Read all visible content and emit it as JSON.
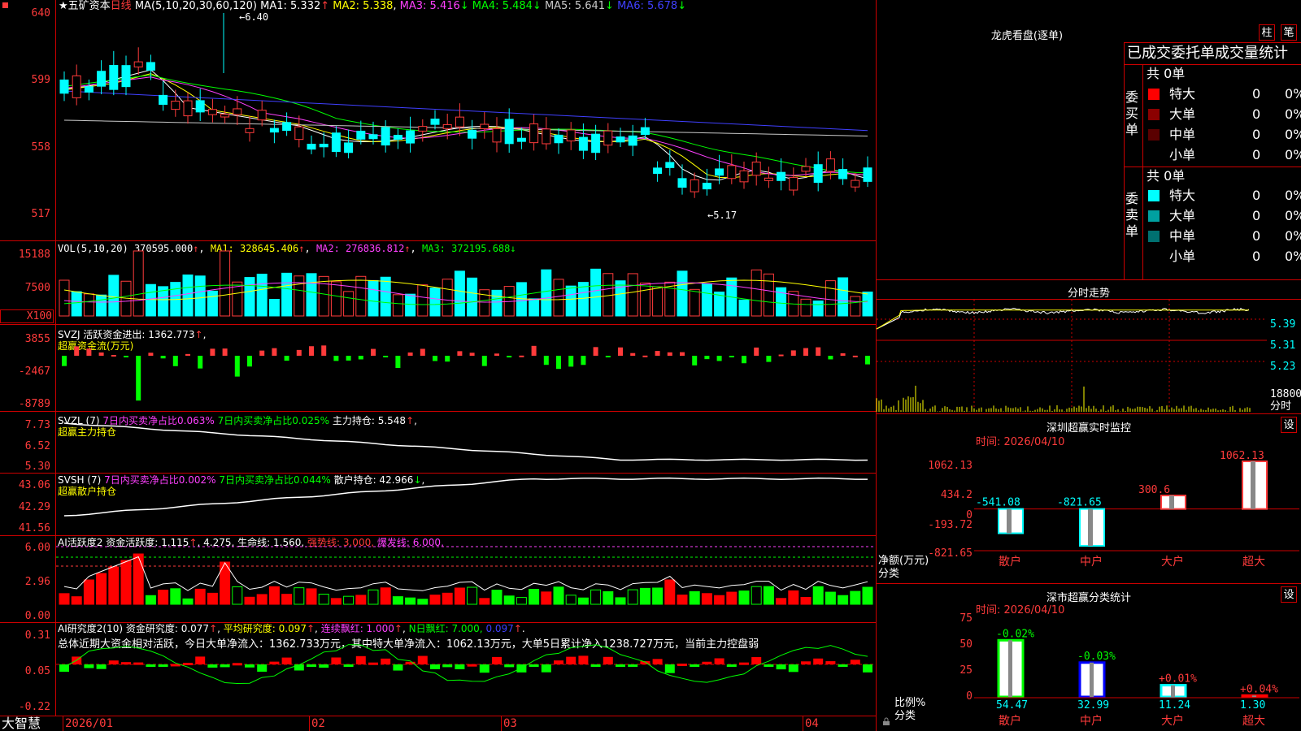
{
  "stock": {
    "name": "五矿资本",
    "star": "★",
    "period": "日线",
    "ma_label": "MA(5,10,20,30,60,120)",
    "ma_values": [
      {
        "label": "MA1:",
        "value": "5.332",
        "arrow": "↑",
        "color": "#ffffff"
      },
      {
        "label": "MA2:",
        "value": "5.338",
        "arrow": ",",
        "color": "#ffff00"
      },
      {
        "label": "MA3:",
        "value": "5.416",
        "arrow": "↓",
        "color": "#ff40ff"
      },
      {
        "label": "MA4:",
        "value": "5.484",
        "arrow": "↓",
        "color": "#00ff00"
      },
      {
        "label": "MA5:",
        "value": "5.641",
        "arrow": "↓",
        "color": "#c8c8c8"
      },
      {
        "label": "MA6:",
        "value": "5.678",
        "arrow": "↓",
        "color": "#4040ff"
      }
    ],
    "high_mark": "6.40",
    "low_mark": "5.17"
  },
  "price_axis": [
    "640",
    "599",
    "558",
    "517"
  ],
  "vol": {
    "label": "VOL(5,10,20)",
    "value": "370595.000",
    "ma1": "MA1: 328645.406",
    "ma2": "MA2: 276836.812",
    "ma3": "MA3: 372195.688",
    "axis": [
      "15188",
      "7500",
      "X100"
    ]
  },
  "svzj": {
    "label": "SVZJ  活跃资金进出:",
    "value": "1362.773",
    "sub": "超赢资金流(万元)",
    "axis": [
      "3855",
      "-2467",
      "-8789"
    ]
  },
  "svzl": {
    "label": "SVZL (7)",
    "p1": "7日内买卖净占比0.063%",
    "p2": "7日内买卖净占比0.025%",
    "p3": "主力持仓: 5.548",
    "sub": "超赢主力持仓",
    "axis": [
      "7.73",
      "6.52",
      "5.30"
    ]
  },
  "svsh": {
    "label": "SVSH (7)",
    "p1": "7日内买卖净占比0.002%",
    "p2": "7日内买卖净占比0.044%",
    "p3": "散户持仓: 42.966",
    "sub": "超赢散户持仓",
    "axis": [
      "43.06",
      "42.29",
      "41.56"
    ]
  },
  "ai1": {
    "label": "AI活跃度2 资金活跃度:",
    "v1": "1.115",
    "v2": "4.275,",
    "v3": "生命线: 1.560,",
    "v4": "强势线: 3.000,",
    "v5": "爆发线: 6.000,",
    "axis": [
      "6.00",
      "2.96",
      "0.00"
    ]
  },
  "ai2": {
    "label": "AI研究度2(10) 资金研究度:",
    "v1": "0.077",
    "v2": "平均研究度: 0.097",
    "v3": "连续飘红: 1.000",
    "v4": "N日飘红: 7.000,",
    "v5": "0.097",
    "summary": "总体近期大资金相对活跃，今日大单净流入：1362.733万元，其中特大单净流入：1062.13万元，大单5日累计净入1238.727万元，当前主力控盘弱",
    "axis": [
      "0.31",
      "0.05",
      "-0.22"
    ]
  },
  "date_axis": [
    "2026/01",
    "02",
    "03",
    "04"
  ],
  "brand": "大智慧",
  "lhkp": {
    "title": "龙虎看盘(逐单)",
    "btn1": "柱",
    "btn2": "笔",
    "header": "已成交委托单成交量统计",
    "buy_label": "委买单",
    "sell_label": "委卖单",
    "buy_total": "共 0单",
    "sell_total": "共 0单",
    "buy_rows": [
      {
        "name": "特大",
        "count": "0",
        "pct": "0%",
        "color": "#ff0000"
      },
      {
        "name": "大单",
        "count": "0",
        "pct": "0%",
        "color": "#8b0000"
      },
      {
        "name": "中单",
        "count": "0",
        "pct": "0%",
        "color": "#5a0000"
      },
      {
        "name": "小单",
        "count": "0",
        "pct": "0%",
        "color": "#000000"
      }
    ],
    "sell_rows": [
      {
        "name": "特大",
        "count": "0",
        "pct": "0%",
        "color": "#00ffff"
      },
      {
        "name": "大单",
        "count": "0",
        "pct": "0%",
        "color": "#00a0a0"
      },
      {
        "name": "中单",
        "count": "0",
        "pct": "0%",
        "color": "#007070"
      },
      {
        "name": "小单",
        "count": "0",
        "pct": "0%",
        "color": "#000000"
      }
    ]
  },
  "intraday": {
    "title": "分时走势",
    "axis": [
      "5.39",
      "5.31",
      "5.23"
    ],
    "vol_axis": [
      "18800",
      "分时"
    ]
  },
  "monitor": {
    "title": "深圳超赢实时监控",
    "settings": "设",
    "time": "时间: 2026/04/10",
    "axis": [
      "1062.13",
      "434.2",
      "0",
      "-193.72",
      "-821.65"
    ],
    "ylabel": "净额(万元)",
    "xlabel": "分类",
    "categories": [
      "散户",
      "中户",
      "大户",
      "超大"
    ],
    "values": [
      -541.08,
      -821.65,
      300.6,
      1062.13
    ],
    "value_labels": [
      "-541.08",
      "-821.65",
      "300.6",
      "1062.13"
    ]
  },
  "classify": {
    "title": "深市超赢分类统计",
    "settings": "设",
    "time": "时间: 2026/04/10",
    "axis": [
      "75",
      "50",
      "25",
      "0"
    ],
    "ylabel": "比例%",
    "xlabel": "分类",
    "categories": [
      "散户",
      "中户",
      "大户",
      "超大"
    ],
    "pct_labels": [
      "-0.02%",
      "-0.03%",
      "+0.01%",
      "+0.04%"
    ],
    "values": [
      54.47,
      32.99,
      11.24,
      1.3
    ],
    "value_labels": [
      "54.47",
      "32.99",
      "11.24",
      "1.30"
    ]
  },
  "chart_data": {
    "type": "bar",
    "title": "深圳超赢实时监控",
    "categories": [
      "散户",
      "中户",
      "大户",
      "超大"
    ],
    "series": [
      {
        "name": "净额(万元)",
        "values": [
          -541.08,
          -821.65,
          300.6,
          1062.13
        ]
      }
    ],
    "ylim": [
      -821.65,
      1062.13
    ]
  }
}
